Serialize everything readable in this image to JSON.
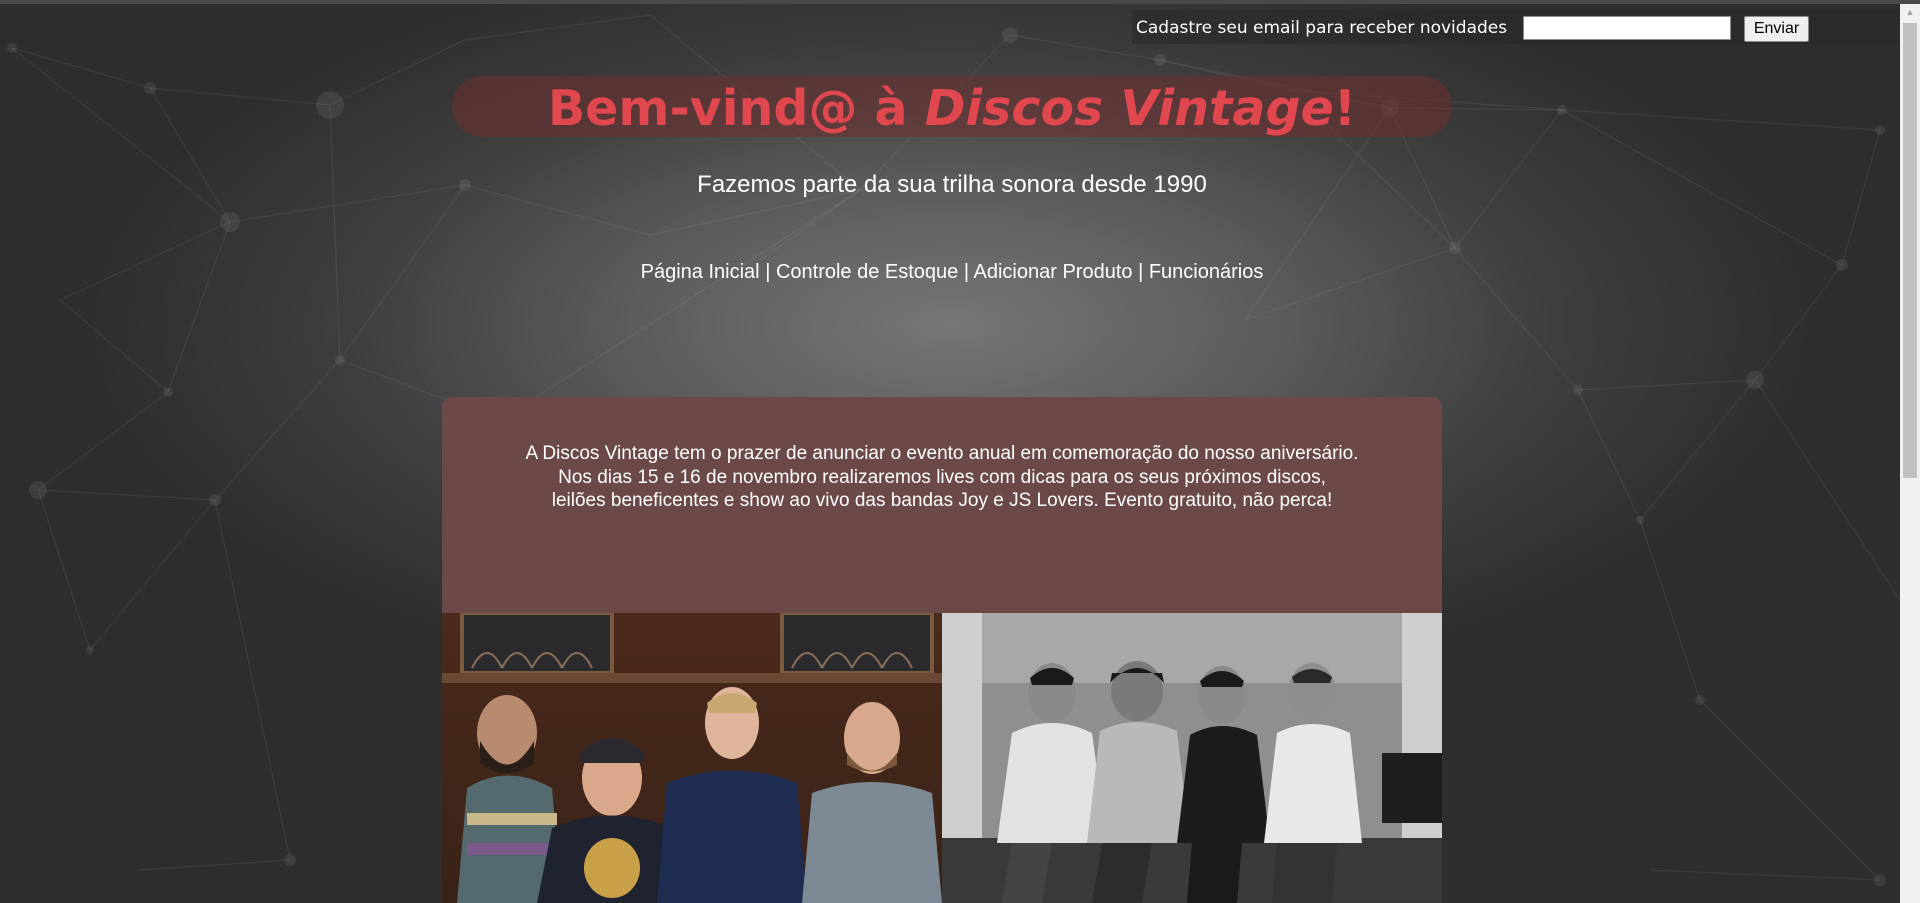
{
  "newsletter": {
    "label": "Cadastre seu email para receber novidades",
    "input_value": "",
    "button_label": "Enviar"
  },
  "header": {
    "title_prefix": "Bem-vind@ à ",
    "title_brand": "Discos Vintage",
    "title_suffix": "!",
    "subtitle": "Fazemos parte da sua trilha sonora desde 1990"
  },
  "nav": {
    "separator": "|",
    "items": [
      {
        "label": "Página Inicial"
      },
      {
        "label": "Controle de Estoque"
      },
      {
        "label": "Adicionar Produto"
      },
      {
        "label": "Funcionários"
      }
    ]
  },
  "announcement": {
    "lines": [
      "A Discos Vintage tem o prazer de anunciar o evento anual em comemoração do nosso aniversário.",
      "Nos dias 15 e 16 de novembro realizaremos lives com dicas para os seus próximos discos,",
      "leilões beneficentes e show ao vivo das bandas Joy e JS Lovers. Evento gratuito, não perca!"
    ]
  },
  "colors": {
    "title": "#e0474e",
    "announcement_bg": "#6c4949",
    "background": "#5b5b5b"
  }
}
